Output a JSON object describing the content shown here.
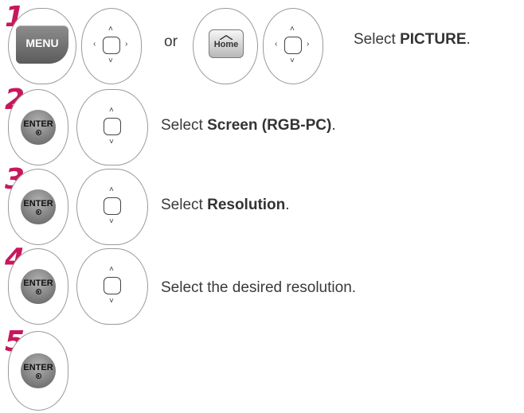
{
  "steps": [
    {
      "number": "1",
      "text_prefix": "Select ",
      "text_bold": "PICTURE",
      "text_suffix": "."
    },
    {
      "number": "2",
      "text_prefix": "Select ",
      "text_bold": "Screen (RGB-PC)",
      "text_suffix": "."
    },
    {
      "number": "3",
      "text_prefix": "Select ",
      "text_bold": "Resolution",
      "text_suffix": "."
    },
    {
      "number": "4",
      "text_prefix": "Select the desired resolution.",
      "text_bold": "",
      "text_suffix": ""
    },
    {
      "number": "5",
      "text_prefix": "",
      "text_bold": "",
      "text_suffix": ""
    }
  ],
  "keys": {
    "menu_label": "MENU",
    "home_label": "Home",
    "enter_label": "ENTER"
  },
  "connector": "or",
  "colors": {
    "step_number": "#c8175d",
    "key_gray": "#6e6e6e"
  },
  "icons": [
    "menu-key-icon",
    "home-key-icon",
    "enter-key-icon",
    "navigation-pad-icon"
  ]
}
